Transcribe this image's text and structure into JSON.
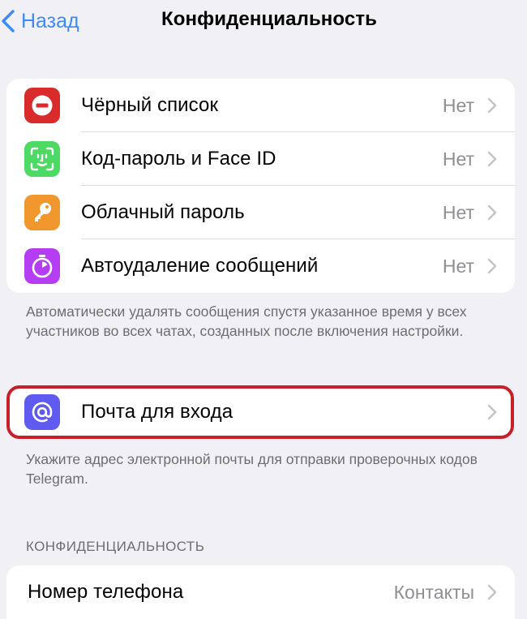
{
  "nav": {
    "back_label": "Назад",
    "title": "Конфиденциальность"
  },
  "security": {
    "items": [
      {
        "label": "Чёрный список",
        "value": "Нет",
        "icon": "block-icon",
        "color": "#d92b2b"
      },
      {
        "label": "Код-пароль и Face ID",
        "value": "Нет",
        "icon": "face-id-icon",
        "color": "#4cd964"
      },
      {
        "label": "Облачный пароль",
        "value": "Нет",
        "icon": "key-icon",
        "color": "#f0982e"
      },
      {
        "label": "Автоудаление сообщений",
        "value": "Нет",
        "icon": "timer-icon",
        "color": "#b53ef4"
      }
    ],
    "footer": "Автоматически удалять сообщения спустя указанное время у всех участников во всех чатах, созданных после включения настройки."
  },
  "login_email": {
    "label": "Почта для входа",
    "icon": "at-icon",
    "color": "#5f5af0",
    "footer": "Укажите адрес электронной почты для отправки проверочных кодов Telegram."
  },
  "privacy": {
    "header": "КОНФИДЕНЦИАЛЬНОСТЬ",
    "items": [
      {
        "label": "Номер телефона",
        "value": "Контакты"
      }
    ]
  },
  "colors": {
    "accent": "#3d8bf7",
    "highlight": "#c8202a",
    "background": "#f0f0f5"
  }
}
